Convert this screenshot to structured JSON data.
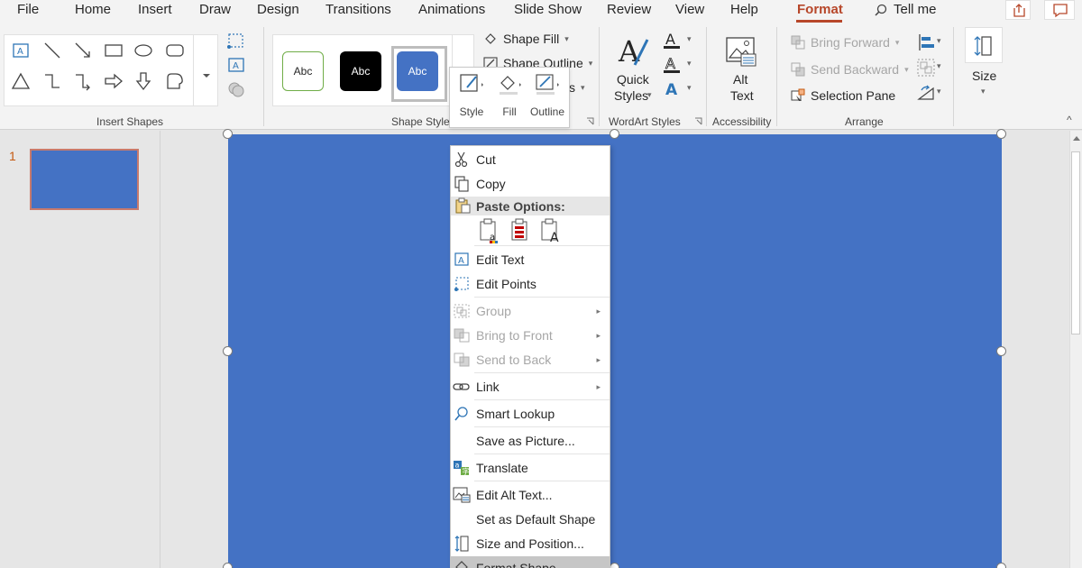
{
  "tabs": [
    {
      "label": "File"
    },
    {
      "label": "Home"
    },
    {
      "label": "Insert"
    },
    {
      "label": "Draw"
    },
    {
      "label": "Design"
    },
    {
      "label": "Transitions"
    },
    {
      "label": "Animations"
    },
    {
      "label": "Slide Show"
    },
    {
      "label": "Review"
    },
    {
      "label": "View"
    },
    {
      "label": "Help"
    },
    {
      "label": "Format"
    },
    {
      "label": "Tell me"
    }
  ],
  "ribbon": {
    "groups": {
      "insert_shapes": "Insert Shapes",
      "shape_styles": "Shape Styles",
      "wordart_styles": "WordArt Styles",
      "accessibility": "Accessibility",
      "arrange": "Arrange"
    },
    "style_swatches": [
      "Abc",
      "Abc",
      "Abc"
    ],
    "shape_fill": "Shape Fill",
    "shape_outline": "Shape Outline",
    "shape_effects_tail": "s",
    "quick_styles_line1": "Quick",
    "quick_styles_line2": "Styles",
    "alt_text_line1": "Alt",
    "alt_text_line2": "Text",
    "bring_forward": "Bring Forward",
    "send_backward": "Send Backward",
    "selection_pane": "Selection Pane",
    "size": "Size"
  },
  "mini_toolbar": {
    "style": "Style",
    "fill": "Fill",
    "outline": "Outline"
  },
  "thumbnails": {
    "slide_number": "1"
  },
  "context_menu": {
    "cut": "Cut",
    "copy": "Copy",
    "paste_options": "Paste Options:",
    "edit_text": "Edit Text",
    "edit_points": "Edit Points",
    "group": "Group",
    "bring_to_front": "Bring to Front",
    "send_to_back": "Send to Back",
    "link": "Link",
    "smart_lookup": "Smart Lookup",
    "save_as_picture": "Save as Picture...",
    "translate": "Translate",
    "edit_alt_text": "Edit Alt Text...",
    "set_default_shape": "Set as Default Shape",
    "size_and_position": "Size and Position...",
    "format_shape": "Format Shape..."
  },
  "colors": {
    "accent": "#b7472a",
    "shape_fill": "#4472c4",
    "thumb_border": "#c87a6c"
  }
}
